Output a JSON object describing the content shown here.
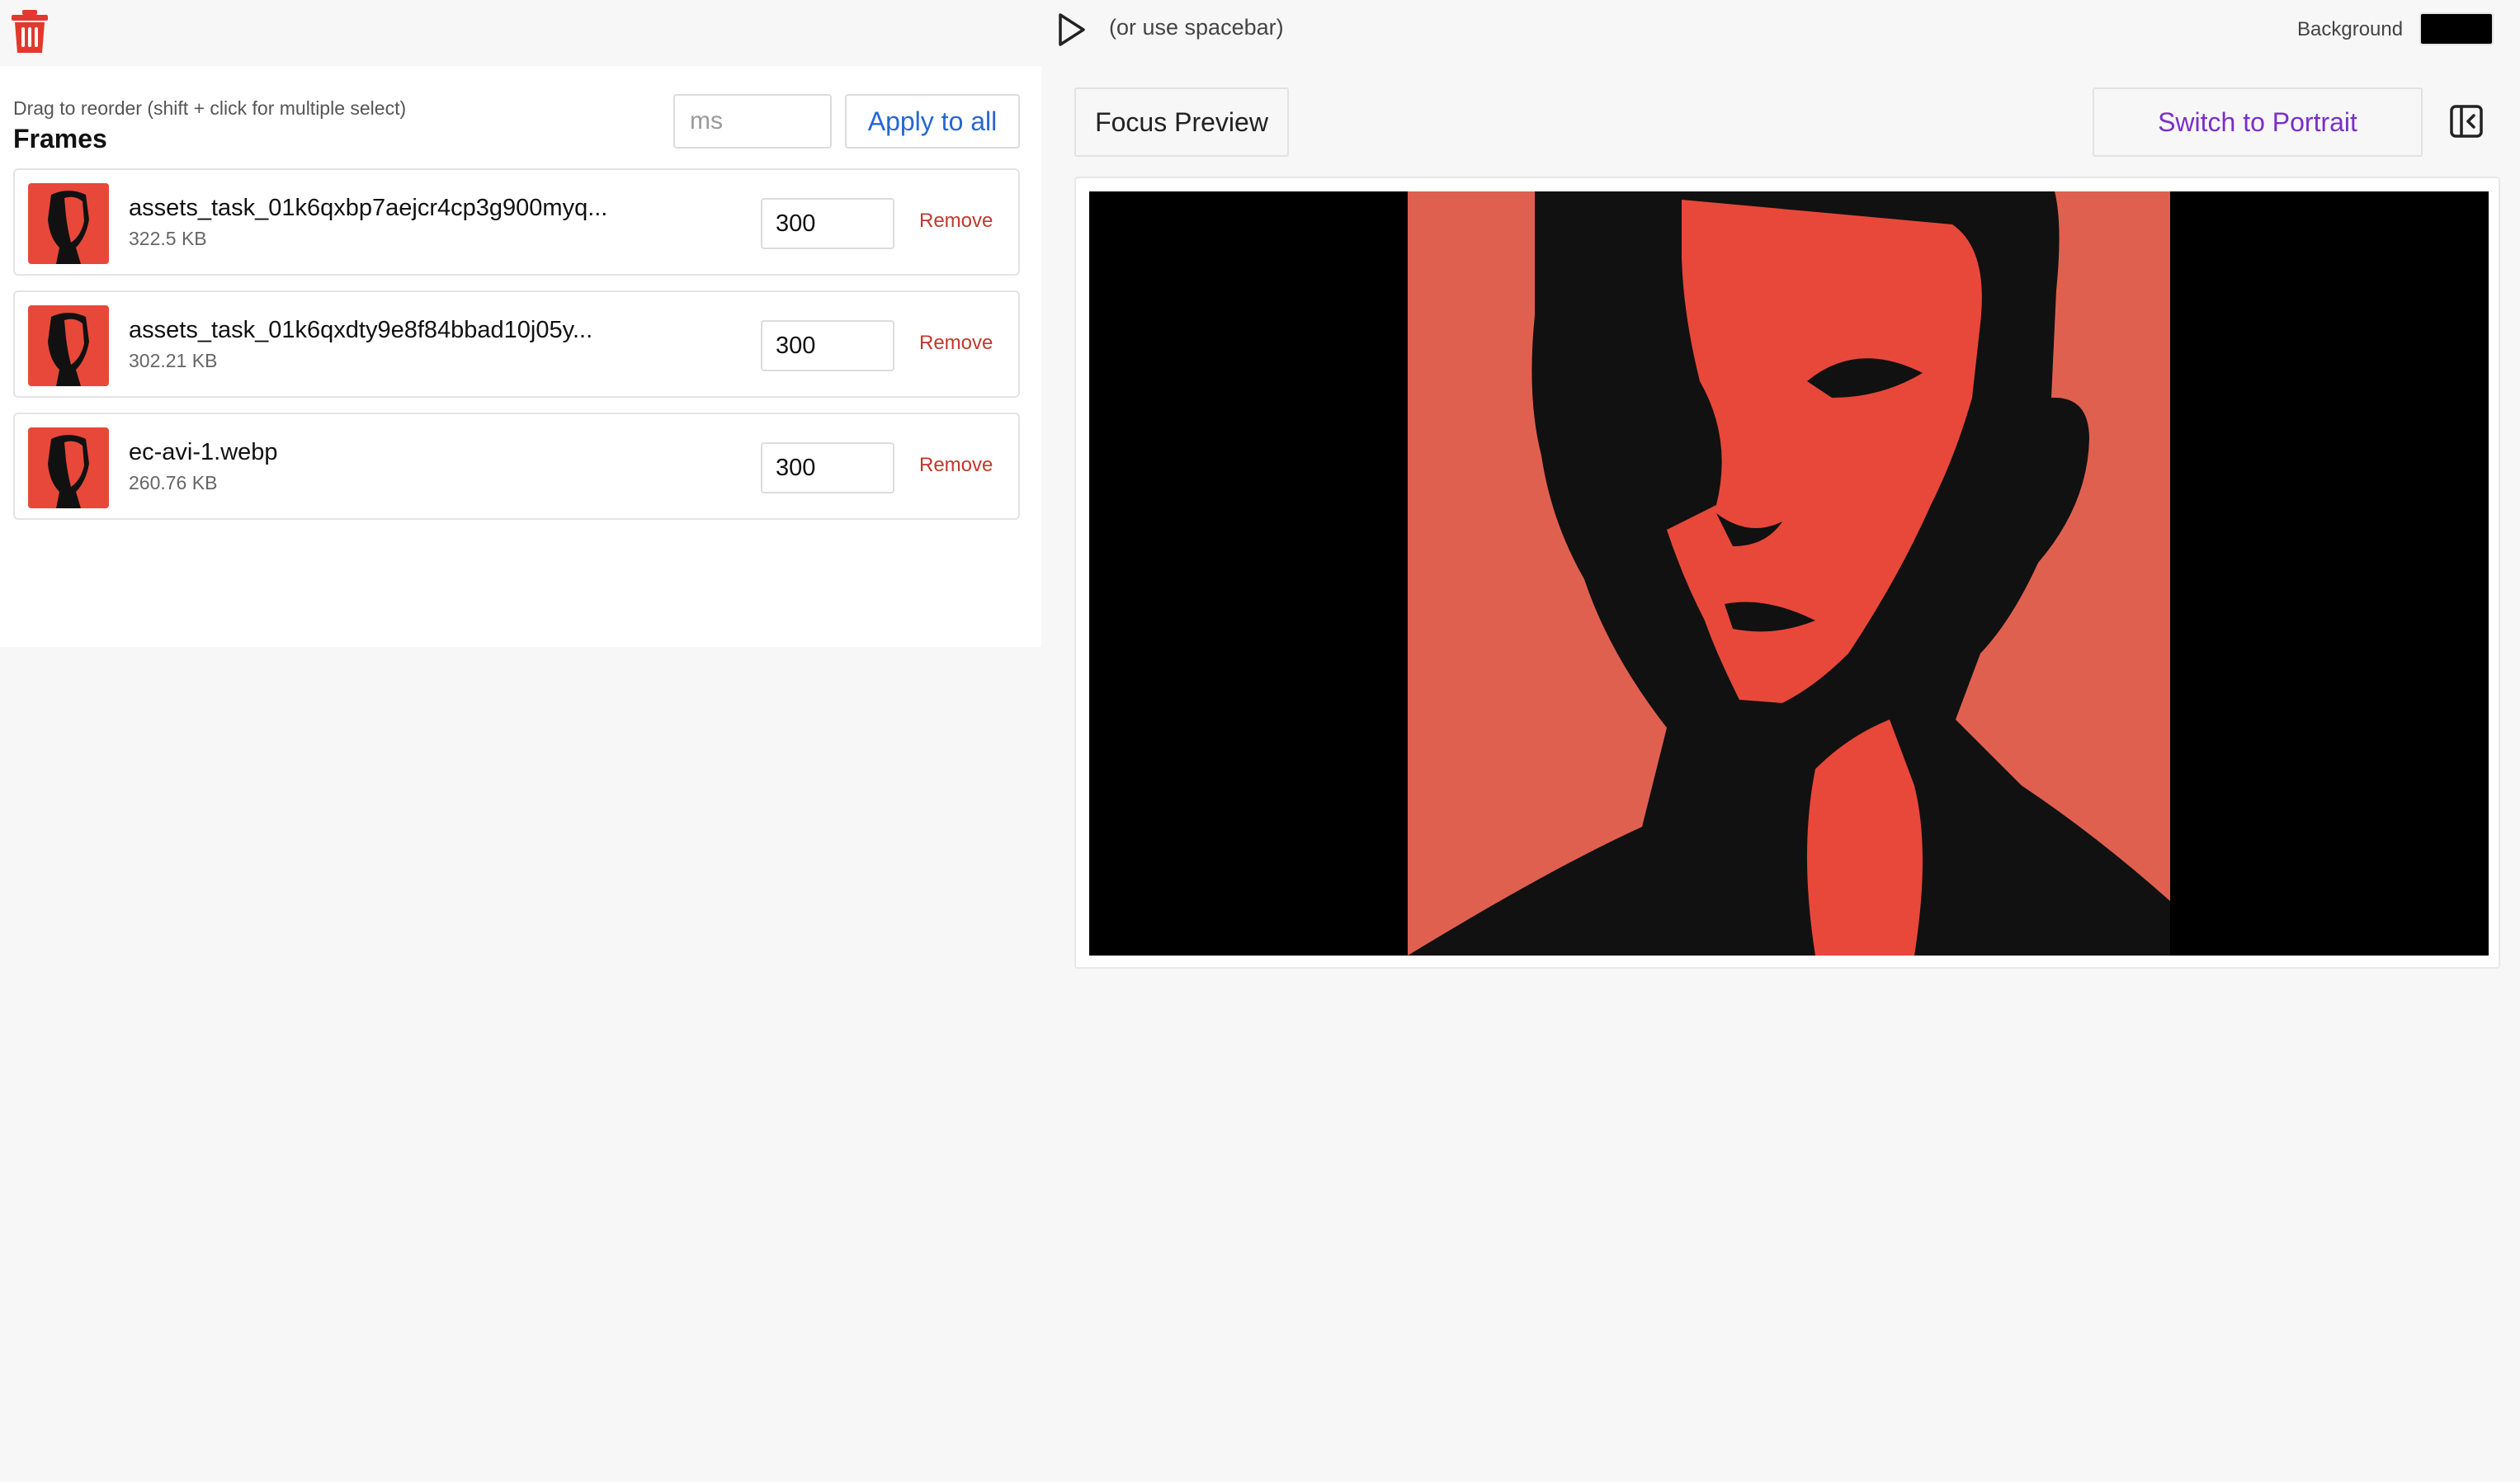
{
  "toolbar": {
    "delete_icon": "trash-icon",
    "play_icon": "play-icon",
    "play_hint": "(or use spacebar)",
    "background_label": "Background",
    "background_color": "#000000"
  },
  "frames_panel": {
    "hint": "Drag to reorder (shift + click for multiple select)",
    "title": "Frames",
    "ms_placeholder": "ms",
    "apply_label": "Apply to all",
    "items": [
      {
        "name": "assets_task_01k6qxbp7aejcr4cp3g900myq...",
        "size": "322.5 KB",
        "duration": "300",
        "remove_label": "Remove"
      },
      {
        "name": "assets_task_01k6qxdty9e8f84bbad10j05y...",
        "size": "302.21 KB",
        "duration": "300",
        "remove_label": "Remove"
      },
      {
        "name": "ec-avi-1.webp",
        "size": "260.76 KB",
        "duration": "300",
        "remove_label": "Remove"
      }
    ]
  },
  "preview_panel": {
    "focus_label": "Focus Preview",
    "orientation_label": "Switch to Portrait",
    "collapse_icon": "sidebar-collapse-icon"
  },
  "colors": {
    "accent_blue": "#2667d1",
    "accent_purple": "#7b2fc7",
    "danger_red": "#c0392b",
    "portrait_red": "#e8483a"
  }
}
